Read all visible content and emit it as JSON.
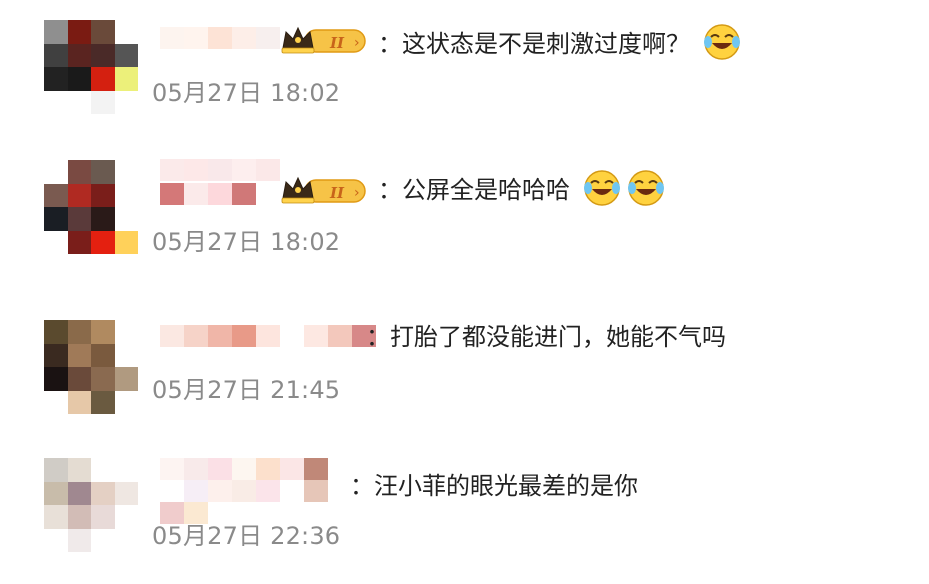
{
  "comments": [
    {
      "text": "：这状态是不是刺激过度啊？",
      "time": "05月27日 18:02",
      "badge": "II"
    },
    {
      "text": "：公屏全是哈哈哈",
      "time": "05月27日 18:02",
      "badge": "II"
    },
    {
      "text": "：打胎了都没能进门，她能不气吗",
      "time": "05月27日 21:45"
    },
    {
      "text": "：汪小菲的眼光最差的是你",
      "time": "05月27日 22:36"
    }
  ],
  "icons": {
    "crown": "crown-level-badge-icon",
    "laugh": "laughing-crying-emoji-icon"
  },
  "colors": {
    "text": "#222222",
    "time": "#8a8a8a",
    "badge_gold": "#f0b21f",
    "badge_text": "#c8641a"
  }
}
